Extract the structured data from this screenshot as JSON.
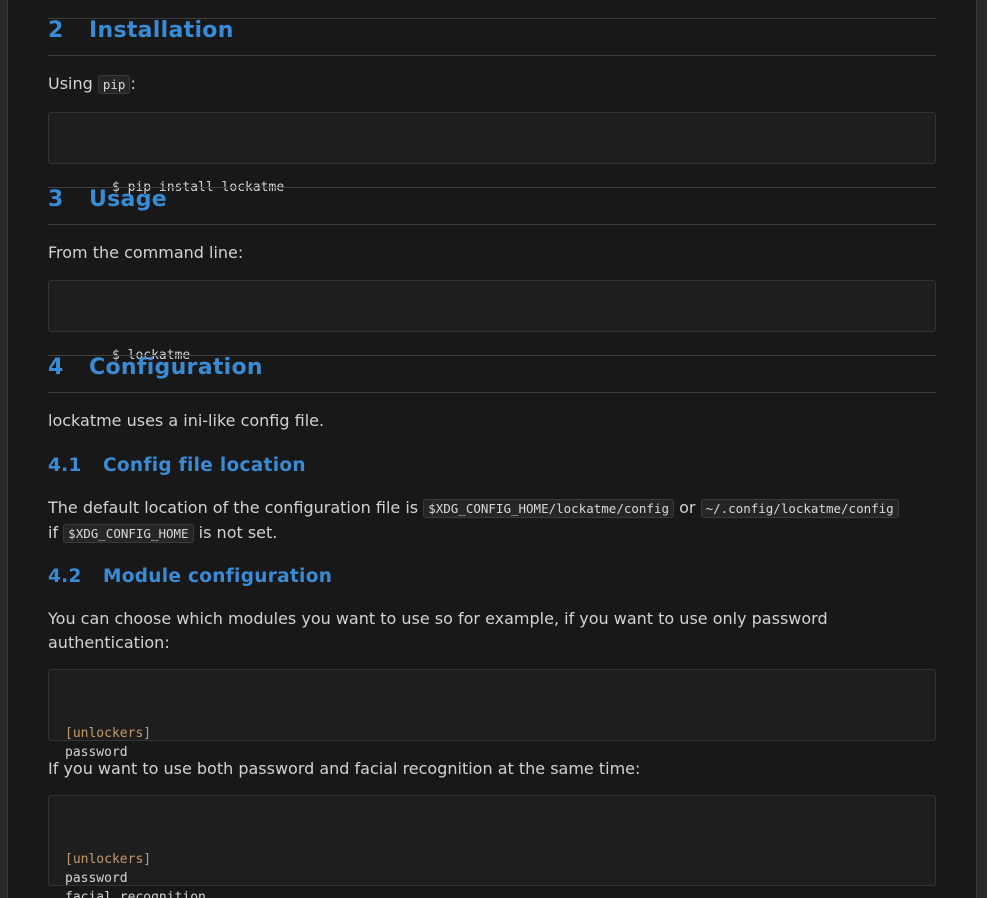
{
  "sections": {
    "installation": {
      "num": "2",
      "title": "Installation",
      "intro_before": "Using ",
      "intro_code": "pip",
      "intro_after": ":",
      "code": "$ pip install lockatme"
    },
    "usage": {
      "num": "3",
      "title": "Usage",
      "intro": "From the command line:",
      "code": "$ lockatme"
    },
    "configuration": {
      "num": "4",
      "title": "Configuration",
      "intro": "lockatme uses a ini-like config file.",
      "location": {
        "num": "4.1",
        "title": "Config file location",
        "text_1": "The default location of the configuration file is ",
        "code_1": "$XDG_CONFIG_HOME/lockatme/config",
        "text_2": " or ",
        "code_2": "~/.config/lockatme/config",
        "text_3": "if ",
        "code_3": "$XDG_CONFIG_HOME",
        "text_4": " is not set."
      },
      "modules": {
        "num": "4.2",
        "title": "Module configuration",
        "text": "You can choose which modules you want to use so for example, if you want to use only password authentication:",
        "example_1": {
          "section": "[unlockers]",
          "line_1": "password"
        },
        "text_2": "If you want to use both password and facial recognition at the same time:",
        "example_2": {
          "section": "[unlockers]",
          "line_1": "password",
          "line_2": "facial_recognition"
        }
      }
    }
  }
}
